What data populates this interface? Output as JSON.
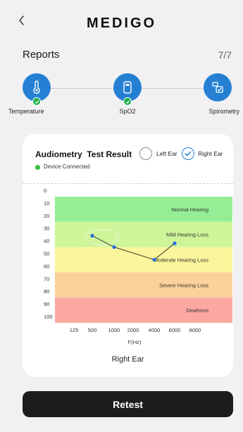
{
  "header": {
    "back_icon": "chevron-left-icon",
    "brand": "MEDIGO"
  },
  "reports": {
    "title": "Reports",
    "count": "7/7"
  },
  "steps": [
    {
      "label": "Temperature",
      "icon": "thermometer-icon",
      "status": "completed"
    },
    {
      "label": "SpO2",
      "icon": "pulse-oximeter-icon",
      "status": "completed"
    },
    {
      "label": "Spirometry",
      "icon": "spirometer-icon",
      "status": "active"
    }
  ],
  "result": {
    "title": "Audiometry  Test Result",
    "device_status": "Device Connected",
    "left_ear_label": "Left Ear",
    "right_ear_label": "Right Ear",
    "selected_ear": "Right Ear"
  },
  "chart_data": {
    "type": "line",
    "xlabel": "F(Hz)",
    "title": "Right Ear",
    "x_ticks": [
      "125",
      "500",
      "1000",
      "2000",
      "4000",
      "6000",
      "8000"
    ],
    "y_ticks": [
      "0",
      "10",
      "20",
      "30",
      "40",
      "50",
      "60",
      "70",
      "80",
      "90",
      "100"
    ],
    "ylim": [
      0,
      100
    ],
    "y_inverted": true,
    "bands": [
      {
        "label": "Normal Hearing",
        "from": 0,
        "to": 20,
        "color": "#95ee95"
      },
      {
        "label": "Mild Hearing Loss",
        "from": 20,
        "to": 40,
        "color": "#cff59a"
      },
      {
        "label": "Moderate Hearing Loss",
        "from": 40,
        "to": 60,
        "color": "#fbf59b"
      },
      {
        "label": "Severe Hearing Loss",
        "from": 60,
        "to": 80,
        "color": "#fbd29b"
      },
      {
        "label": "Deafness",
        "from": 80,
        "to": 100,
        "color": "#fba8a0"
      }
    ],
    "series": [
      {
        "points": [
          {
            "x": "500",
            "y": 31
          },
          {
            "x": "1000",
            "y": 40
          },
          {
            "x": "4000",
            "y": 50
          },
          {
            "x": "6000",
            "y": 37
          }
        ],
        "color": "#2d6ee0"
      }
    ]
  },
  "actions": {
    "retest_label": "Retest"
  }
}
